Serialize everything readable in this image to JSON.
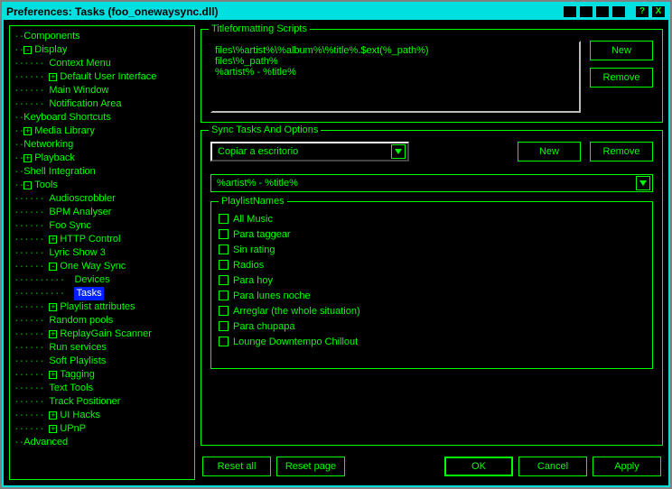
{
  "window": {
    "title": "Preferences: Tasks (foo_onewaysync.dll)"
  },
  "tree": [
    {
      "ind": 0,
      "exp": null,
      "label": "Components"
    },
    {
      "ind": 0,
      "exp": "-",
      "label": "Display"
    },
    {
      "ind": 1,
      "exp": null,
      "label": "Context Menu"
    },
    {
      "ind": 1,
      "exp": "+",
      "label": "Default User Interface"
    },
    {
      "ind": 1,
      "exp": null,
      "label": "Main Window"
    },
    {
      "ind": 1,
      "exp": null,
      "label": "Notification Area"
    },
    {
      "ind": 0,
      "exp": null,
      "label": "Keyboard Shortcuts"
    },
    {
      "ind": 0,
      "exp": "+",
      "label": "Media Library"
    },
    {
      "ind": 0,
      "exp": null,
      "label": "Networking"
    },
    {
      "ind": 0,
      "exp": "+",
      "label": "Playback"
    },
    {
      "ind": 0,
      "exp": null,
      "label": "Shell Integration"
    },
    {
      "ind": 0,
      "exp": "-",
      "label": "Tools"
    },
    {
      "ind": 1,
      "exp": null,
      "label": "Audioscrobbler"
    },
    {
      "ind": 1,
      "exp": null,
      "label": "BPM Analyser"
    },
    {
      "ind": 1,
      "exp": null,
      "label": "Foo Sync"
    },
    {
      "ind": 1,
      "exp": "+",
      "label": "HTTP Control"
    },
    {
      "ind": 1,
      "exp": null,
      "label": "Lyric Show 3"
    },
    {
      "ind": 1,
      "exp": "-",
      "label": "One Way Sync"
    },
    {
      "ind": 2,
      "exp": null,
      "label": "Devices"
    },
    {
      "ind": 2,
      "exp": null,
      "label": "Tasks",
      "selected": true
    },
    {
      "ind": 1,
      "exp": "+",
      "label": "Playlist attributes"
    },
    {
      "ind": 1,
      "exp": null,
      "label": "Random pools"
    },
    {
      "ind": 1,
      "exp": "+",
      "label": "ReplayGain Scanner"
    },
    {
      "ind": 1,
      "exp": null,
      "label": "Run services"
    },
    {
      "ind": 1,
      "exp": null,
      "label": "Soft Playlists"
    },
    {
      "ind": 1,
      "exp": "+",
      "label": "Tagging"
    },
    {
      "ind": 1,
      "exp": null,
      "label": "Text Tools"
    },
    {
      "ind": 1,
      "exp": null,
      "label": "Track Positioner"
    },
    {
      "ind": 1,
      "exp": "+",
      "label": "UI Hacks"
    },
    {
      "ind": 1,
      "exp": "+",
      "label": "UPnP"
    },
    {
      "ind": 0,
      "exp": null,
      "label": "Advanced"
    }
  ],
  "scripts": {
    "title": "Titleformatting Scripts",
    "text": "files\\%artist%\\%album%\\%title%.$ext(%_path%)\nfiles\\%_path%\n%artist% - %title%",
    "new": "New",
    "remove": "Remove"
  },
  "sync": {
    "title": "Sync Tasks And Options",
    "task_selected": "Copiar a escritorio",
    "new": "New",
    "remove": "Remove",
    "format_selected": "%artist% - %title%",
    "playlists_title": "PlaylistNames",
    "playlists": [
      "All Music",
      "Para taggear",
      "Sin rating",
      "Radios",
      "Para hoy",
      "Para lunes noche",
      "Arreglar (the whole situation)",
      "Para chupapa",
      "Lounge Downtempo Chillout"
    ]
  },
  "buttons": {
    "reset_all": "Reset all",
    "reset_page": "Reset page",
    "ok": "OK",
    "cancel": "Cancel",
    "apply": "Apply"
  },
  "help_icon": "?",
  "close_icon": "X"
}
